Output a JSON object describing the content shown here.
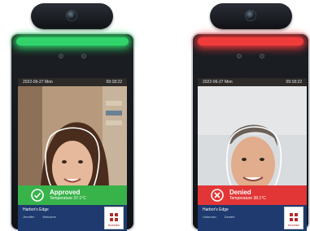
{
  "devices": [
    {
      "id": "approved",
      "led_color": "#31d46b",
      "date": "2022-06-27 Mon",
      "time": "09:18:22",
      "result": {
        "title": "Approved",
        "temperature": "Temperature 37.1°C",
        "color": "#37b34a",
        "icon": "check-circle-icon"
      },
      "company": "Harbor's Edge",
      "info_labels": [
        "Jennifer",
        "Welcome"
      ],
      "logo_text": "PAXTON"
    },
    {
      "id": "denied",
      "led_color": "#f03b3b",
      "date": "2022-06-27 Mon",
      "time": "09:18:22",
      "result": {
        "title": "Denied",
        "temperature": "Temperature 38.1°C",
        "color": "#e23636",
        "icon": "x-circle-icon"
      },
      "company": "Harbor's Edge",
      "info_labels": [
        "Unknown",
        "Denied"
      ],
      "logo_text": "PAXTON"
    }
  ]
}
